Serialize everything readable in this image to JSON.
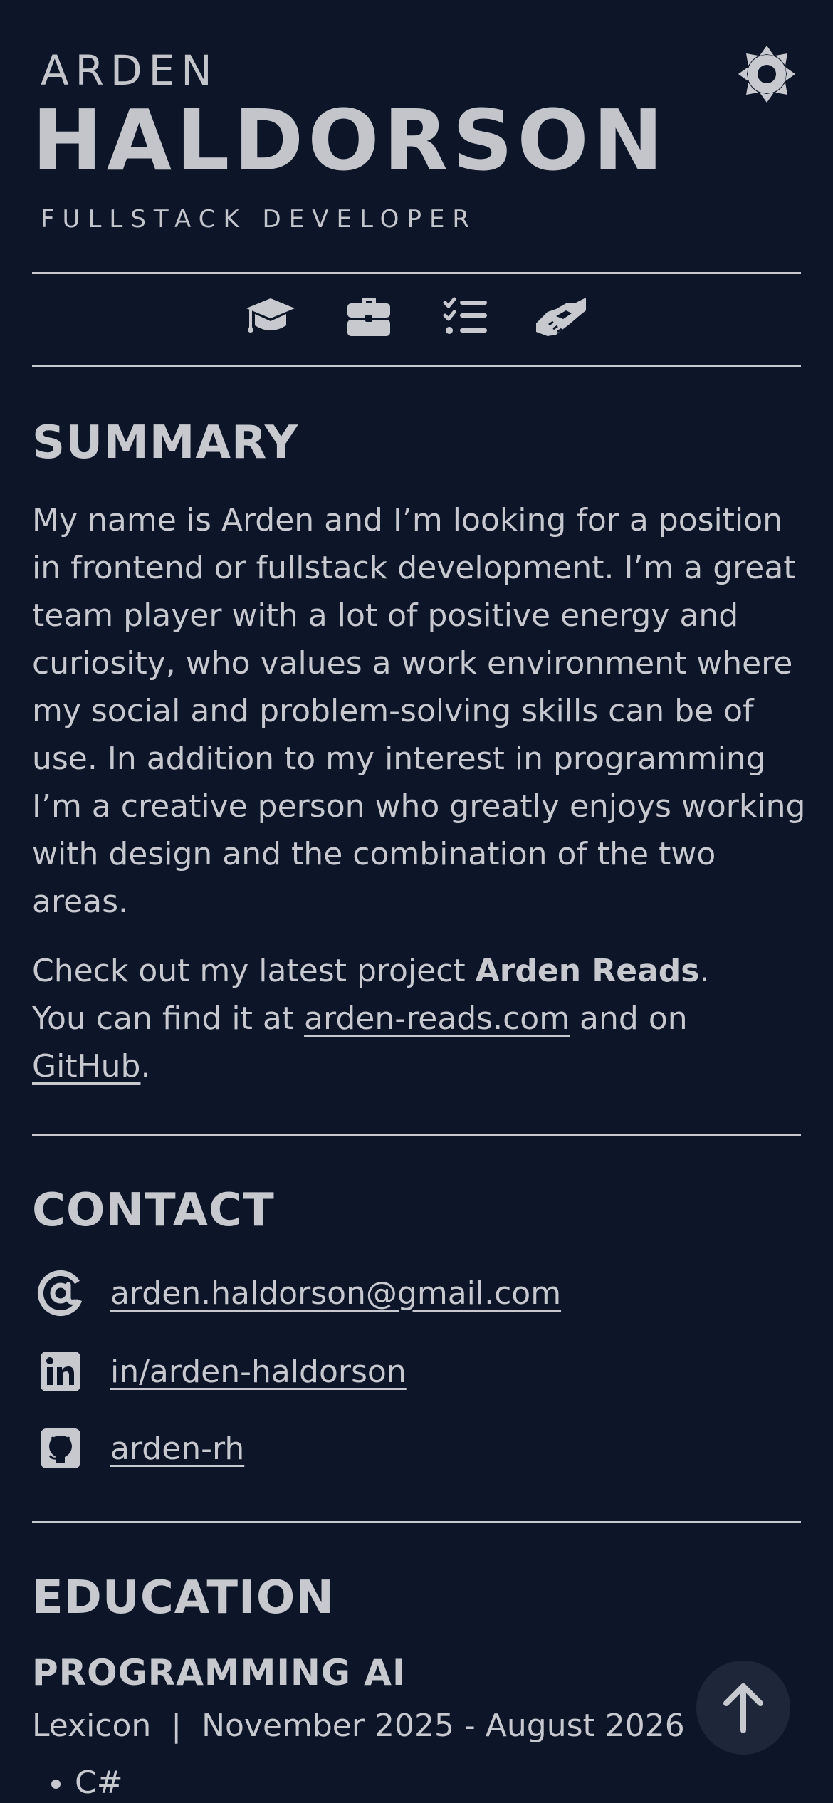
{
  "header": {
    "first_name": "ARDEN",
    "last_name": "HALDORSON",
    "subtitle": "FULLSTACK DEVELOPER"
  },
  "theme_toggle": {
    "icon": "sun-gear-icon"
  },
  "nav": {
    "items": [
      {
        "icon": "graduation-cap-icon",
        "target": "education"
      },
      {
        "icon": "briefcase-icon",
        "target": "experience"
      },
      {
        "icon": "checklist-icon",
        "target": "skills"
      },
      {
        "icon": "handshake-icon",
        "target": "references"
      }
    ]
  },
  "summary": {
    "title": "SUMMARY",
    "paragraph": "My name is Arden and I’m looking for a position in frontend or fullstack development. I’m a great team player with a lot of positive energy and curiosity, who values a work environment where my social and problem-solving skills can be of use. In addition to my interest in programming I’m a creative person who greatly enjoys working with design and the combination of the two areas.",
    "project_prefix": "Check out my latest project ",
    "project_name": "Arden Reads",
    "project_suffix": ".",
    "find_prefix": "You can find it at ",
    "site_link": "arden-reads.com",
    "find_middle": " and on",
    "github_link": "GitHub",
    "find_suffix": "."
  },
  "contact": {
    "title": "CONTACT",
    "email": "arden.haldorson@gmail.com",
    "linkedin": "in/arden-haldorson",
    "github": "arden-rh"
  },
  "education": {
    "title": "EDUCATION",
    "entries": [
      {
        "title": "PROGRAMMING AI",
        "meta": "Lexicon  |  November 2025 - August 2026",
        "items": [
          "C#"
        ]
      }
    ]
  },
  "colors": {
    "background": "#0d1629",
    "text": "#c7c9cf",
    "button_bg": "#1e2739"
  }
}
